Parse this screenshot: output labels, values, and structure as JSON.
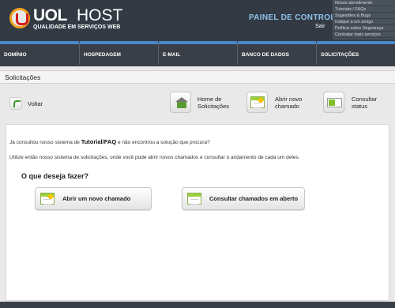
{
  "header": {
    "logo_uol": "UOL",
    "logo_host": "HOST",
    "logo_sub": "QUALIDADE EM SERVIÇOS WEB",
    "panel_title": "PAINEL DE CONTROLE",
    "sair": "Sair",
    "top_links": [
      "Nosso atendimento",
      "Tutoriais / FAQs",
      "Sugestões & Bugs",
      "Indique a um amigo",
      "Política sobre Segurança",
      "Contratar mais serviços"
    ]
  },
  "nav": {
    "items": [
      "DOMÍNIO",
      "HOSPEDAGEM",
      "E-MAIL",
      "BANCO DE DADOS",
      "SOLICITAÇÕES"
    ]
  },
  "page": {
    "title": "Solicitações",
    "voltar": "Voltar",
    "home_line1": "Home de",
    "home_line2": "Solicitações",
    "abrir_line1": "Abrir novo",
    "abrir_line2": "chamado",
    "consultar_line1": "Consultar",
    "consultar_line2": "status"
  },
  "panel": {
    "text1_before": "Já consultou nosso sistema de ",
    "text1_bold": "Tutorial/FAQ",
    "text1_after": " e não encontrou a solução que procura?",
    "text2": "Utilize então nosso sistema de solicitações, onde você pode abrir novos chamados e consultar o andamento de cada um deles.",
    "question": "O que deseja fazer?",
    "btn_abrir": "Abrir um novo chamado",
    "btn_consultar": "Consultar chamados em aberto"
  },
  "colors": {
    "header_bg": "#333a44",
    "nav_accent": "#4a88c8",
    "panel_title": "#8fc3ea",
    "icon_green": "#9ccf3c"
  }
}
